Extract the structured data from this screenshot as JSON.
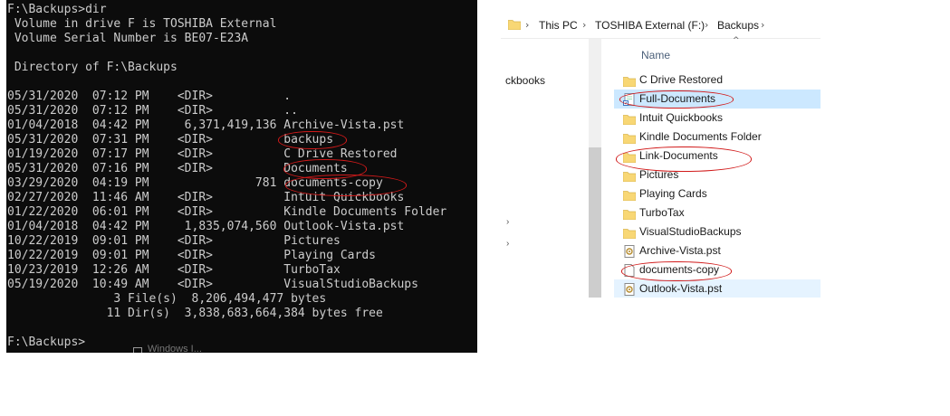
{
  "console": {
    "lines": [
      "F:\\Backups>dir",
      " Volume in drive F is TOSHIBA External",
      " Volume Serial Number is BE07-E23A",
      "",
      " Directory of F:\\Backups",
      "",
      "05/31/2020  07:12 PM    <DIR>          .",
      "05/31/2020  07:12 PM    <DIR>          ..",
      "01/04/2018  04:42 PM     6,371,419,136 Archive-Vista.pst",
      "05/31/2020  07:31 PM    <DIR>          backups",
      "01/19/2020  07:17 PM    <DIR>          C Drive Restored",
      "05/31/2020  07:16 PM    <DIR>          Documents",
      "03/29/2020  04:19 PM               781 documents-copy",
      "02/27/2020  11:46 AM    <DIR>          Intuit Quickbooks",
      "01/22/2020  06:01 PM    <DIR>          Kindle Documents Folder",
      "01/04/2018  04:42 PM     1,835,074,560 Outlook-Vista.pst",
      "10/22/2019  09:01 PM    <DIR>          Pictures",
      "10/22/2019  09:01 PM    <DIR>          Playing Cards",
      "10/23/2019  12:26 AM    <DIR>          TurboTax",
      "05/19/2020  10:49 AM    <DIR>          VisualStudioBackups",
      "               3 File(s)  8,206,494,477 bytes",
      "              11 Dir(s)  3,838,683,664,384 bytes free",
      "",
      "F:\\Backups>"
    ],
    "ghost_text": "Windows I..."
  },
  "explorer": {
    "breadcrumb": [
      "This PC",
      "TOSHIBA External (F:)",
      "Backups"
    ],
    "column_header": "Name",
    "sort_glyph": "^",
    "nav_item": "ckbooks",
    "items": [
      {
        "name": "C Drive Restored",
        "icon": "folder-icon"
      },
      {
        "name": "Full-Documents",
        "icon": "shortcut-icon"
      },
      {
        "name": "Intuit Quickbooks",
        "icon": "folder-icon"
      },
      {
        "name": "Kindle Documents Folder",
        "icon": "folder-icon"
      },
      {
        "name": "Link-Documents",
        "icon": "folder-icon"
      },
      {
        "name": "Pictures",
        "icon": "folder-icon"
      },
      {
        "name": "Playing Cards",
        "icon": "folder-icon"
      },
      {
        "name": "TurboTax",
        "icon": "folder-icon"
      },
      {
        "name": "VisualStudioBackups",
        "icon": "folder-icon"
      },
      {
        "name": "Archive-Vista.pst",
        "icon": "pst-file-icon"
      },
      {
        "name": "documents-copy",
        "icon": "blank-file-icon"
      },
      {
        "name": "Outlook-Vista.pst",
        "icon": "pst-file-icon"
      }
    ]
  },
  "colors": {
    "console_bg": "#0c0c0c",
    "console_text": "#cccccc",
    "selection": "#cce8ff",
    "hover": "#e5f3ff",
    "annotation": "#d11a1a",
    "folder": "#f8d775"
  }
}
